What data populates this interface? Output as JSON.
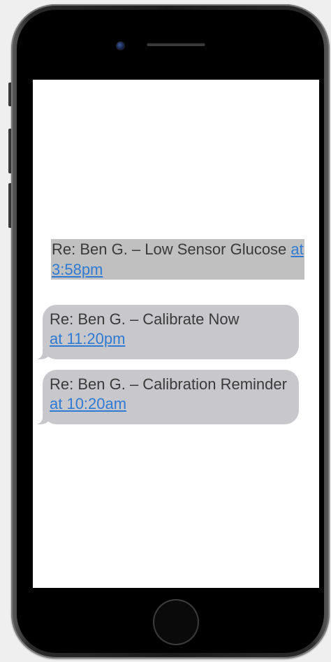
{
  "messages": [
    {
      "text": "Re: Ben G. – Low Sensor Glucose ",
      "time": "at 3:58pm"
    },
    {
      "text": "Re: Ben G. – Calibrate Now ",
      "time": "at 11:20pm"
    },
    {
      "text": "Re: Ben G. – Calibration Reminder ",
      "time": "at 10:20am"
    }
  ],
  "colors": {
    "bubble": "#c7c7cc",
    "highlight": "#c0c0c0",
    "link": "#2f7bd4",
    "text": "#3a3a3a"
  }
}
